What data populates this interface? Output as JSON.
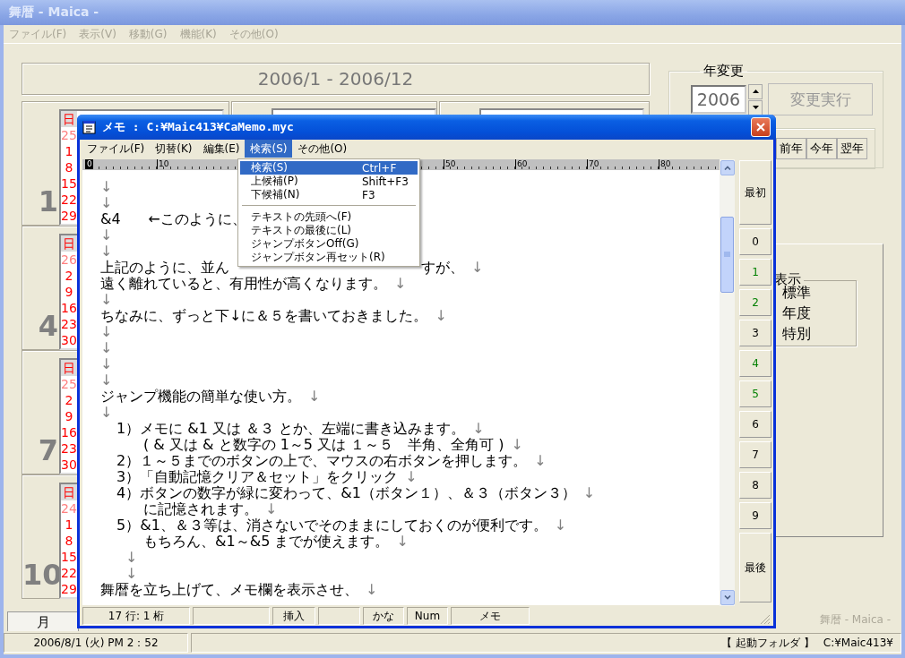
{
  "window": {
    "title": "舞暦 - Maica -"
  },
  "menu": [
    "ファイル(F)",
    "表示(V)",
    "移動(G)",
    "機能(K)",
    "その他(O)"
  ],
  "range_title": "2006/1 - 2006/12",
  "months": [
    {
      "number": "1",
      "days": [
        {
          "kind": "header",
          "text": "日"
        },
        {
          "kind": "prev",
          "text": "25"
        },
        {
          "kind": "date",
          "text": "1"
        },
        {
          "kind": "date",
          "text": "8"
        },
        {
          "kind": "date",
          "text": "15"
        },
        {
          "kind": "date",
          "text": "22"
        },
        {
          "kind": "date",
          "text": "29"
        }
      ]
    },
    {
      "number": "4",
      "days": [
        {
          "kind": "header",
          "text": "日"
        },
        {
          "kind": "prev",
          "text": "26"
        },
        {
          "kind": "date",
          "text": "2"
        },
        {
          "kind": "date",
          "text": "9"
        },
        {
          "kind": "date",
          "text": "16"
        },
        {
          "kind": "date",
          "text": "23"
        },
        {
          "kind": "date",
          "text": "30"
        }
      ]
    },
    {
      "number": "7",
      "days": [
        {
          "kind": "header",
          "text": "日"
        },
        {
          "kind": "prev",
          "text": "25"
        },
        {
          "kind": "date",
          "text": "2"
        },
        {
          "kind": "date",
          "text": "9"
        },
        {
          "kind": "date",
          "text": "16"
        },
        {
          "kind": "date",
          "text": "23"
        },
        {
          "kind": "date",
          "text": "30"
        }
      ]
    },
    {
      "number": "10",
      "days": [
        {
          "kind": "header",
          "text": "日"
        },
        {
          "kind": "prev",
          "text": "24"
        },
        {
          "kind": "date",
          "text": "1"
        },
        {
          "kind": "date",
          "text": "8"
        },
        {
          "kind": "date",
          "text": "15"
        },
        {
          "kind": "date",
          "text": "22"
        },
        {
          "kind": "date",
          "text": "29"
        }
      ]
    }
  ],
  "year_change": {
    "title": "年変更",
    "year": "2006",
    "apply": {
      "label": "変更実行",
      "disabled": true
    },
    "buttons": [
      "前年",
      "今年",
      "翌年"
    ]
  },
  "display": {
    "title": "表示",
    "options": [
      "標準",
      "年度",
      "特別"
    ]
  },
  "tabs": [
    {
      "label": "月",
      "selected": true
    }
  ],
  "app_label": "舞暦 - Maica -",
  "status_bar": {
    "date": "2006/8/1 (火) PM 2：52",
    "folder_label": "【 起動フォルダ 】",
    "folder": "C:¥Maic413¥"
  },
  "memo": {
    "title": "メモ : C:¥Maic413¥CaMemo.myc",
    "menu": [
      {
        "label": "ファイル(F)",
        "selected": false
      },
      {
        "label": "切替(K)",
        "selected": false
      },
      {
        "label": "編集(E)",
        "selected": false
      },
      {
        "label": "検索(S)",
        "selected": true
      },
      {
        "label": "その他(O)",
        "selected": false
      }
    ],
    "ruler": [
      {
        "kind": "mark",
        "label": "0",
        "selected": true
      },
      {
        "kind": "mark",
        "label": "10",
        "selected": false
      },
      {
        "kind": "hidden"
      },
      {
        "kind": "hidden"
      },
      {
        "kind": "hidden"
      },
      {
        "kind": "mark",
        "label": "50",
        "selected": false
      },
      {
        "kind": "mark",
        "label": "60",
        "selected": false
      },
      {
        "kind": "mark",
        "label": "70",
        "selected": false
      },
      {
        "kind": "mark",
        "label": "80",
        "selected": false
      }
    ],
    "lines": [
      {
        "kind": "plain",
        "eol": "↓"
      },
      {
        "kind": "plain",
        "eol": "↓"
      },
      {
        "kind": "plain",
        "text": "&4      ←このように、"
      },
      {
        "kind": "plain",
        "eol": "↓"
      },
      {
        "kind": "plain",
        "eol": "↓"
      },
      {
        "kind": "plain",
        "text": "上記のように、並ん",
        "text_after": "すが、",
        "eol": "↓"
      },
      {
        "kind": "plain",
        "text": "遠く離れていると、有用性が高くなります。",
        "eol": "↓"
      },
      {
        "kind": "plain",
        "eol": "↓"
      },
      {
        "kind": "plain",
        "text": "ちなみに、ずっと下↓に＆５を書いておきました。",
        "eol": "↓"
      },
      {
        "kind": "plain",
        "eol": "↓"
      },
      {
        "kind": "plain",
        "eol": "↓"
      },
      {
        "kind": "plain",
        "eol": "↓"
      },
      {
        "kind": "plain",
        "eol": "↓"
      },
      {
        "kind": "plain",
        "text": "ジャンプ機能の簡単な使い方。",
        "eol": "↓"
      },
      {
        "kind": "plain",
        "eol": "↓"
      },
      {
        "kind": "step",
        "text": "1）メモに &1 又は ＆３ とか、左端に書き込みます。",
        "eol": "↓"
      },
      {
        "kind": "cont",
        "text": "( & 又は & と数字の 1～5 又は １～５　半角、全角可 )",
        "eol": "↓"
      },
      {
        "kind": "step",
        "text": "2）１～５までのボタンの上で、マウスの右ボタンを押します。",
        "eol": "↓"
      },
      {
        "kind": "step",
        "text": "3）「自動記憶クリア＆セット」をクリック",
        "eol": "↓"
      },
      {
        "kind": "step",
        "text": "4）ボタンの数字が緑に変わって、&1（ボタン１）、＆３（ボタン３）",
        "eol": "↓"
      },
      {
        "kind": "cont",
        "text": "に記憶されます。",
        "eol": "↓"
      },
      {
        "kind": "step",
        "text": "5）&1、＆３等は、消さないでそのままにしておくのが便利です。",
        "eol": "↓"
      },
      {
        "kind": "cont",
        "text": "もちろん、&1～&5 までが使えます。",
        "eol": "↓"
      },
      {
        "kind": "mark",
        "eol": "↓"
      },
      {
        "kind": "mark",
        "eol": "↓"
      },
      {
        "kind": "plain",
        "text": "舞暦を立ち上げて、メモ欄を表示させ、",
        "eol": "↓"
      }
    ],
    "jump_buttons": {
      "first": "最初",
      "last": "最後",
      "numbers": [
        {
          "label": "0",
          "set": false
        },
        {
          "label": "1",
          "set": true
        },
        {
          "label": "2",
          "set": true
        },
        {
          "label": "3",
          "set": false
        },
        {
          "label": "4",
          "set": true
        },
        {
          "label": "5",
          "set": true
        },
        {
          "label": "6",
          "set": false
        },
        {
          "label": "7",
          "set": false
        },
        {
          "label": "8",
          "set": false
        },
        {
          "label": "9",
          "set": false
        }
      ]
    },
    "status": [
      {
        "kind": "text",
        "text": "17 行: 1 桁"
      },
      {
        "kind": "blank"
      },
      {
        "kind": "text",
        "text": "挿入"
      },
      {
        "kind": "blank"
      },
      {
        "kind": "text",
        "text": "かな"
      },
      {
        "kind": "text",
        "text": "Num"
      },
      {
        "kind": "text",
        "text": "メモ"
      }
    ],
    "dropdown": [
      {
        "kind": "item",
        "label": "検索(S)",
        "shortcut": "Ctrl+F",
        "selected": true
      },
      {
        "kind": "item",
        "label": "上候補(P)",
        "shortcut": "Shift+F3",
        "selected": false
      },
      {
        "kind": "item",
        "label": "下候補(N)",
        "shortcut": "F3",
        "selected": false
      },
      {
        "kind": "separator"
      },
      {
        "kind": "item",
        "label": "テキストの先頭へ(F)",
        "selected": false
      },
      {
        "kind": "item",
        "label": "テキストの最後に(L)",
        "selected": false
      },
      {
        "kind": "item",
        "label": "ジャンプボタンOff(G)",
        "selected": false
      },
      {
        "kind": "item",
        "label": "ジャンプボタン再セット(R)",
        "selected": false
      }
    ]
  }
}
